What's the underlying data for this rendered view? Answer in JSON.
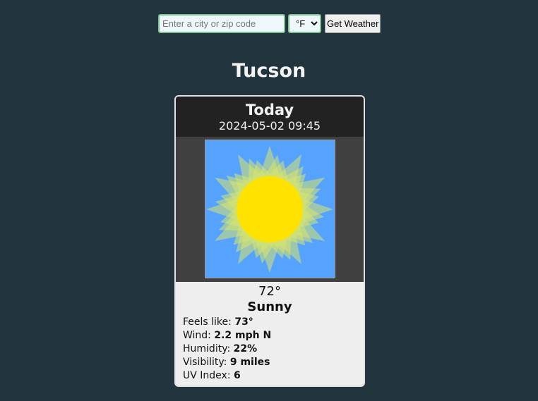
{
  "search": {
    "placeholder": "Enter a city or zip code",
    "value": "",
    "unit_selected": "°F",
    "unit_options": [
      "°F",
      "°C"
    ],
    "submit_label": "Get Weather"
  },
  "location": {
    "city": "Tucson"
  },
  "forecast": {
    "day_label": "Today",
    "datetime": "2024-05-02 09:45",
    "icon": "sunny-icon",
    "temperature": "72°",
    "condition": "Sunny",
    "details": [
      {
        "label": "Feels like:",
        "value": "73°"
      },
      {
        "label": "Wind:",
        "value": "2.2 mph N"
      },
      {
        "label": "Humidity:",
        "value": "22%"
      },
      {
        "label": "Visibility:",
        "value": "9 miles"
      },
      {
        "label": "UV Index:",
        "value": "6"
      }
    ]
  },
  "colors": {
    "page_background": "#22343d",
    "card_header": "#222222",
    "image_frame": "#404040",
    "sky": "#56a2ff",
    "sun": "#ffe200",
    "rays": "#d8e56a"
  }
}
